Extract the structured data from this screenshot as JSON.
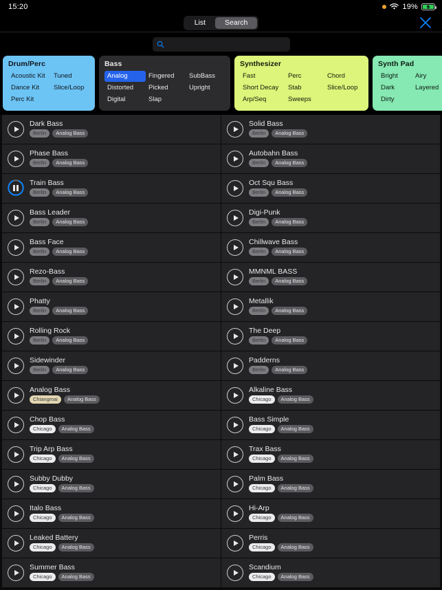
{
  "status": {
    "time": "15:20",
    "battery_pct": "19%",
    "icons": [
      "recording-dot-icon",
      "wifi-icon",
      "battery-charging-icon"
    ]
  },
  "toolbar": {
    "segments": [
      {
        "label": "List",
        "active": false
      },
      {
        "label": "Search",
        "active": true
      }
    ],
    "close_label": "close-icon"
  },
  "search": {
    "value": "",
    "placeholder": ""
  },
  "categories": [
    {
      "title": "Drum/Perc",
      "accent": "#6cc4f5",
      "options": [
        {
          "label": "Acoustic Kit",
          "selected": false
        },
        {
          "label": "Tuned",
          "selected": false
        },
        {
          "label": "Dance Kit",
          "selected": false
        },
        {
          "label": "Slice/Loop",
          "selected": false
        },
        {
          "label": "Perc Kit",
          "selected": false
        }
      ]
    },
    {
      "title": "Bass",
      "accent": "#2c2c2e",
      "options": [
        {
          "label": "Analog",
          "selected": true
        },
        {
          "label": "Fingered",
          "selected": false
        },
        {
          "label": "SubBass",
          "selected": false
        },
        {
          "label": "Distorted",
          "selected": false
        },
        {
          "label": "Picked",
          "selected": false
        },
        {
          "label": "Upright",
          "selected": false
        },
        {
          "label": "Digital",
          "selected": false
        },
        {
          "label": "Slap",
          "selected": false
        }
      ]
    },
    {
      "title": "Synthesizer",
      "accent": "#dcf57a",
      "options": [
        {
          "label": "Fast",
          "selected": false
        },
        {
          "label": "Perc",
          "selected": false
        },
        {
          "label": "Chord",
          "selected": false
        },
        {
          "label": "Short Decay",
          "selected": false
        },
        {
          "label": "Stab",
          "selected": false
        },
        {
          "label": "Slice/Loop",
          "selected": false
        },
        {
          "label": "Arp/Seq",
          "selected": false
        },
        {
          "label": "Sweeps",
          "selected": false
        }
      ]
    },
    {
      "title": "Synth Pad",
      "accent": "#86e8b2",
      "options": [
        {
          "label": "Bright",
          "selected": false
        },
        {
          "label": "Airy",
          "selected": false
        },
        {
          "label": "Dark",
          "selected": false
        },
        {
          "label": "Layered",
          "selected": false
        },
        {
          "label": "Dirty",
          "selected": false
        }
      ]
    }
  ],
  "results": {
    "left": [
      {
        "name": "Dark Bass",
        "location": "Berlin",
        "kind": "Analog Bass",
        "state": "paused"
      },
      {
        "name": "Phase Bass",
        "location": "Berlin",
        "kind": "Analog Bass",
        "state": "paused"
      },
      {
        "name": "Train Bass",
        "location": "Berlin",
        "kind": "Analog Bass",
        "state": "playing"
      },
      {
        "name": "Bass Leader",
        "location": "Berlin",
        "kind": "Analog Bass",
        "state": "paused"
      },
      {
        "name": "Bass Face",
        "location": "Berlin",
        "kind": "Analog Bass",
        "state": "paused"
      },
      {
        "name": "Rezo-Bass",
        "location": "Berlin",
        "kind": "Analog Bass",
        "state": "paused"
      },
      {
        "name": "Phatty",
        "location": "Berlin",
        "kind": "Analog Bass",
        "state": "paused"
      },
      {
        "name": "Rolling Rock",
        "location": "Berlin",
        "kind": "Analog Bass",
        "state": "paused"
      },
      {
        "name": "Sidewinder",
        "location": "Berlin",
        "kind": "Analog Bass",
        "state": "paused"
      },
      {
        "name": "Analog Bass",
        "location": "Chiangmai",
        "kind": "Analog Bass",
        "state": "paused"
      },
      {
        "name": "Chop Bass",
        "location": "Chicago",
        "kind": "Analog Bass",
        "state": "paused"
      },
      {
        "name": "Trip Arp Bass",
        "location": "Chicago",
        "kind": "Analog Bass",
        "state": "paused"
      },
      {
        "name": "Subby Dubby",
        "location": "Chicago",
        "kind": "Analog Bass",
        "state": "paused"
      },
      {
        "name": "Italo Bass",
        "location": "Chicago",
        "kind": "Analog Bass",
        "state": "paused"
      },
      {
        "name": "Leaked Battery",
        "location": "Chicago",
        "kind": "Analog Bass",
        "state": "paused"
      },
      {
        "name": "Summer Bass",
        "location": "Chicago",
        "kind": "Analog Bass",
        "state": "paused"
      }
    ],
    "right": [
      {
        "name": "Solid Bass",
        "location": "Berlin",
        "kind": "Analog Bass",
        "state": "paused"
      },
      {
        "name": "Autobahn Bass",
        "location": "Berlin",
        "kind": "Analog Bass",
        "state": "paused"
      },
      {
        "name": "Oct Squ Bass",
        "location": "Berlin",
        "kind": "Analog Bass",
        "state": "paused"
      },
      {
        "name": "Digi-Punk",
        "location": "Berlin",
        "kind": "Analog Bass",
        "state": "paused"
      },
      {
        "name": "Chillwave Bass",
        "location": "Berlin",
        "kind": "Analog Bass",
        "state": "paused"
      },
      {
        "name": "MMNML BASS",
        "location": "Berlin",
        "kind": "Analog Bass",
        "state": "paused"
      },
      {
        "name": "Metallik",
        "location": "Berlin",
        "kind": "Analog Bass",
        "state": "paused"
      },
      {
        "name": "The Deep",
        "location": "Berlin",
        "kind": "Analog Bass",
        "state": "paused"
      },
      {
        "name": "Padderns",
        "location": "Berlin",
        "kind": "Analog Bass",
        "state": "paused"
      },
      {
        "name": "Alkaline Bass",
        "location": "Chicago",
        "kind": "Analog Bass",
        "state": "paused"
      },
      {
        "name": "Bass Simple",
        "location": "Chicago",
        "kind": "Analog Bass",
        "state": "paused"
      },
      {
        "name": "Trax Bass",
        "location": "Chicago",
        "kind": "Analog Bass",
        "state": "paused"
      },
      {
        "name": "Palm Bass",
        "location": "Chicago",
        "kind": "Analog Bass",
        "state": "paused"
      },
      {
        "name": "Hi-Arp",
        "location": "Chicago",
        "kind": "Analog Bass",
        "state": "paused"
      },
      {
        "name": "Perris",
        "location": "Chicago",
        "kind": "Analog Bass",
        "state": "paused"
      },
      {
        "name": "Scandium",
        "location": "Chicago",
        "kind": "Analog Bass",
        "state": "paused"
      }
    ]
  }
}
